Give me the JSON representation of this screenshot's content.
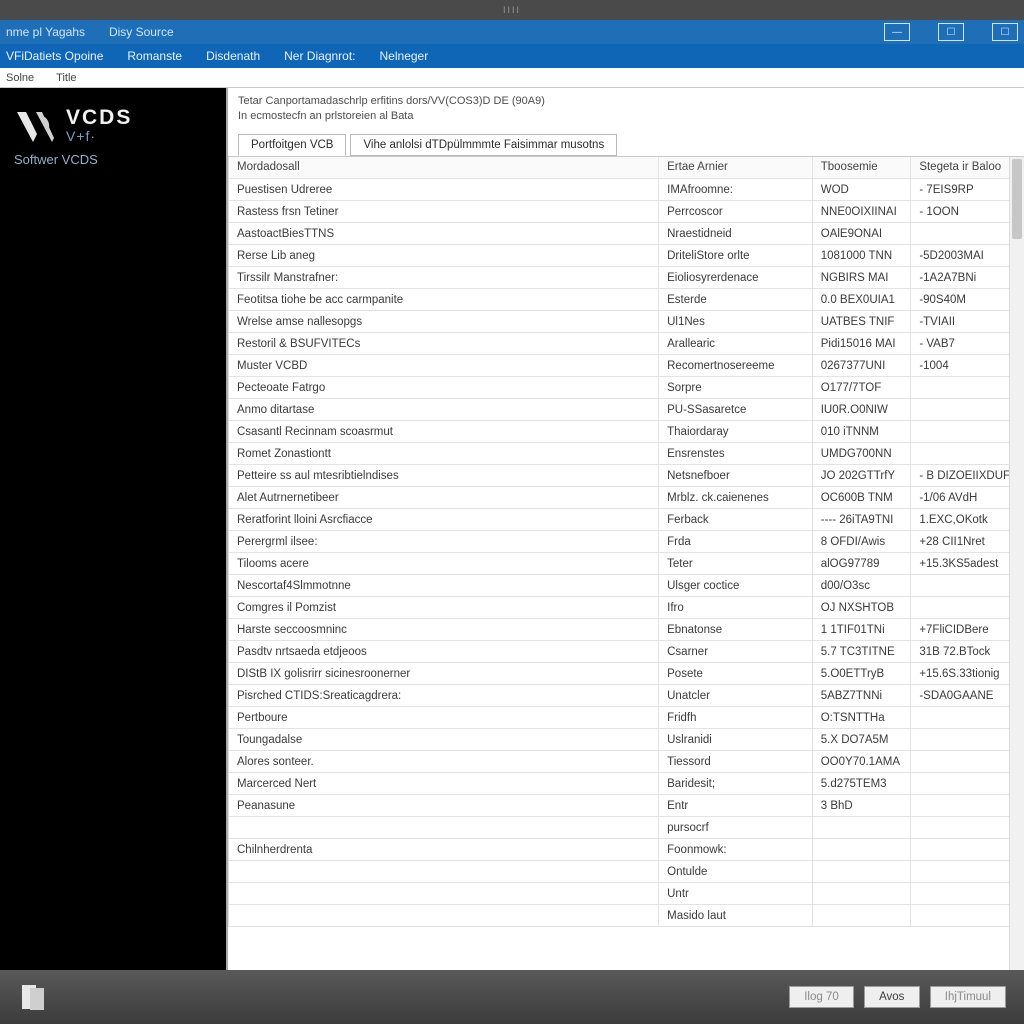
{
  "titlebar_mini": "IIII",
  "menubar1": {
    "left": [
      "nme pl Yagahs",
      "Disy Source"
    ],
    "win_icons": [
      "—",
      "☐",
      "☐"
    ]
  },
  "menubar2": [
    "VFiDatiets Opoine",
    "Romanste",
    "Disdenath",
    "Ner Diagnrot:",
    "Nelneger"
  ],
  "menubar3": [
    "Solne",
    "Title"
  ],
  "sidebar": {
    "brand_line1": "VCDS",
    "brand_line2": "V+f·",
    "brand_line3": "Softwer  VCDS"
  },
  "descr_line1": "Tetar Canportamadaschrlp erfitins dors/VV(COS3)D DE (90A9)",
  "descr_line2": "In ecmostecfn an prlstoreien al Bata",
  "tabs": [
    {
      "label": "Portfoitgen VCB",
      "active": true
    },
    {
      "label": "Vihe anlolsi dTDpülmmmte Faisimmar musotns",
      "active": false
    }
  ],
  "columns": [
    "Mordadosall",
    "Ertae Arnier",
    "Tboosemie",
    "Stegeta ir Baloo"
  ],
  "rows": [
    [
      "Puestisen Udreree",
      "IMAfroomne:",
      "WOD",
      "- 7EIS9RP"
    ],
    [
      "Rastess frsn Tetiner",
      "Perrcoscor",
      "NNE0OIXIINAI",
      "- 1OON"
    ],
    [
      "AastoactBiesTTNS",
      "Nraestidneid",
      "OAlE9ONAI",
      ""
    ],
    [
      "Rerse Lib aneg",
      "DriteliStore orlte",
      "1081000 TNN",
      "-5D2003MAI"
    ],
    [
      "Tirssilr Manstrafner:",
      "Eioliosyrerdenace",
      "NGBIRS MAI",
      "-1A2A7BNi"
    ],
    [
      "Feotitsa tiohe be acc carmpanite",
      "Esterde",
      "0.0 BEX0UIA1",
      "-90S40M"
    ],
    [
      "Wrelse amse nallesopgs",
      "Ul1Nes",
      "UATBES TNIF",
      "-TVIAII"
    ],
    [
      "Restoril & BSUFVITECs",
      "Arallearic",
      "Pidi15016 MAI",
      "- VAB7"
    ],
    [
      "Muster VCBD",
      "Recomertnosereeme",
      "0267377UNI",
      "-1004"
    ],
    [
      "Pecteoate Fatrgo",
      "Sorpre",
      "O177/7TOF",
      ""
    ],
    [
      "Anmo ditartase",
      "PU-SSasaretce",
      "IU0R.O0NIW",
      ""
    ],
    [
      "Csasantl Recinnam scoasrmut",
      "Thaiordaray",
      "010 iTNNM",
      ""
    ],
    [
      "Romet Zonastiontt",
      "Ensrenstes",
      "UMDG700NN",
      ""
    ],
    [
      "Petteire ss aul mtesribtielndises",
      "Netsnefboer",
      "JO 202GTTrfY",
      "- B DIZOEIIXDUF"
    ],
    [
      "Alet Autrnernetibeer",
      "Mrblz. ck.caienenes",
      "OC600B TNM",
      "-1/06 AVdH"
    ],
    [
      "Reratforint lloini Asrcfiacce",
      "Ferback",
      "---- 26iTA9TNI",
      "1.EXC,OKotk"
    ],
    [
      "Perergrml ilsee:",
      "Frda",
      "8 OFDI/Awis",
      "+28 CII1Nret"
    ],
    [
      "Tilooms acere",
      "Teter",
      "alOG97789",
      "+15.3KS5adest"
    ],
    [
      "Nescortaf4Slmmotnne",
      "Ulsger coctice",
      "d00/O3sc",
      ""
    ],
    [
      "Comgres il Pomzist",
      "Ifro",
      "OJ NXSHTOB",
      ""
    ],
    [
      "Harste seccoosmninc",
      "Ebnatonse",
      "1 1TIF01TNi",
      "+7FliCIDBere"
    ],
    [
      "Pasdtv nrtsaeda etdjeoos",
      "Csarner",
      "5.7 TC3TITNE",
      "31B 72.BTock"
    ],
    [
      "DIStB IX golisrirr sicinesroonerner",
      "Posete",
      "5.O0ETTryB",
      "+15.6S.33tionig"
    ],
    [
      "Pisrched CTIDS:Sreaticagdrera:",
      "Unatcler",
      "5ABZ7TNNi",
      "-SDA0GAANE"
    ],
    [
      "Pertboure",
      "Fridfh",
      "O:TSNTTHa",
      ""
    ],
    [
      "Toungadalse",
      "Uslranidi",
      "5.X DO7A5M",
      ""
    ],
    [
      "Alores sonteer.",
      "Tiessord",
      "OO0Y70.1AMA",
      ""
    ],
    [
      "Marcerced Nert",
      "Baridesit;",
      "5.d275TEM3",
      ""
    ],
    [
      "Peanasune",
      "Entr",
      "3 BhD",
      ""
    ],
    [
      "",
      "pursocrf",
      "",
      ""
    ],
    [
      "Chilnherdrenta",
      "Foonmowk:",
      "",
      ""
    ],
    [
      "",
      "Ontulde",
      "",
      ""
    ],
    [
      "",
      "Untr",
      "",
      ""
    ],
    [
      "",
      "Masido laut",
      "",
      ""
    ]
  ],
  "footer": {
    "buttons": [
      "Ilog 70",
      "Avos",
      "IhjTimuul"
    ]
  }
}
